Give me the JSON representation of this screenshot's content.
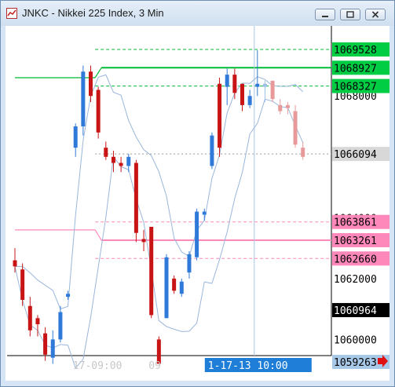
{
  "window": {
    "title": "JNKC - Nikkei 225 Index, 3 Min",
    "buttons": [
      "minimize",
      "restore",
      "close"
    ]
  },
  "chart_data": {
    "type": "candlestick",
    "symbol": "JNKC",
    "title": "JNKC - Nikkei 225 Index, 3 Min",
    "y_axis": {
      "ticks": [
        "1068000",
        "1066000",
        "1064000",
        "1062000",
        "1060000"
      ],
      "tick_values": [
        1068000,
        1066000,
        1064000,
        1062000,
        1060000
      ],
      "range": [
        1058500,
        1070500
      ]
    },
    "price_labels": [
      {
        "text": "1069528",
        "value": 1069528,
        "bg": "#00cc44",
        "fg": "#000000"
      },
      {
        "text": "1068927",
        "value": 1068927,
        "bg": "#00cc44",
        "fg": "#000000"
      },
      {
        "text": "1068327",
        "value": 1068327,
        "bg": "#00cc44",
        "fg": "#000000"
      },
      {
        "text": "1066094",
        "value": 1066094,
        "bg": "#d8d8d8",
        "fg": "#000000"
      },
      {
        "text": "1063861",
        "value": 1063861,
        "bg": "#ff88bb",
        "fg": "#000000"
      },
      {
        "text": "1063261",
        "value": 1063261,
        "bg": "#ff88bb",
        "fg": "#000000"
      },
      {
        "text": "1062660",
        "value": 1062660,
        "bg": "#ff88bb",
        "fg": "#000000"
      },
      {
        "text": "1060964",
        "value": 1060964,
        "bg": "#000000",
        "fg": "#ffffff"
      },
      {
        "text": "1059263",
        "value": 1059263,
        "bg": "#a8c8e8",
        "fg": "#000000"
      }
    ],
    "time_labels": [
      {
        "text": "17-09:00",
        "bar": 12
      },
      {
        "text": "09",
        "bar": 22
      }
    ],
    "crosshair_label": {
      "text": "1-17-13  10:00",
      "bar": 32
    },
    "crosshair_bar": 32,
    "session_start_bar": 11,
    "levels": {
      "green_solid": {
        "value": 1068927,
        "before": 1068600,
        "from_bar": 11
      },
      "green_dashed": [
        1069528,
        1068327
      ],
      "pink_solid": {
        "value": 1063261,
        "before": 1063600,
        "from_bar": 11
      },
      "pink_dashed": [
        1063861,
        1062660
      ],
      "pivot_dashed": 1066094
    },
    "candles": [
      {
        "o": 1062600,
        "h": 1063000,
        "l": 1062200,
        "c": 1062400
      },
      {
        "o": 1062300,
        "h": 1062500,
        "l": 1061100,
        "c": 1061300
      },
      {
        "o": 1061100,
        "h": 1061400,
        "l": 1060100,
        "c": 1060300
      },
      {
        "o": 1060700,
        "h": 1060800,
        "l": 1060100,
        "c": 1060500
      },
      {
        "o": 1060200,
        "h": 1060400,
        "l": 1059300,
        "c": 1059500
      },
      {
        "o": 1059400,
        "h": 1060300,
        "l": 1059200,
        "c": 1060000
      },
      {
        "o": 1060000,
        "h": 1061100,
        "l": 1059900,
        "c": 1060900
      },
      {
        "o": 1061400,
        "h": 1061600,
        "l": 1061300,
        "c": 1061500
      },
      {
        "o": 1066300,
        "h": 1067100,
        "l": 1066000,
        "c": 1067000
      },
      {
        "o": 1067000,
        "h": 1069000,
        "l": 1066700,
        "c": 1068800
      },
      {
        "o": 1068800,
        "h": 1069000,
        "l": 1067800,
        "c": 1068000
      },
      {
        "o": 1068200,
        "h": 1068300,
        "l": 1066600,
        "c": 1066800
      },
      {
        "o": 1066300,
        "h": 1066500,
        "l": 1065900,
        "c": 1066000
      },
      {
        "o": 1066000,
        "h": 1066200,
        "l": 1065500,
        "c": 1065800
      },
      {
        "o": 1065800,
        "h": 1066000,
        "l": 1065500,
        "c": 1065700
      },
      {
        "o": 1065700,
        "h": 1066100,
        "l": 1065500,
        "c": 1066000
      },
      {
        "o": 1065800,
        "h": 1065900,
        "l": 1063200,
        "c": 1063500
      },
      {
        "o": 1063300,
        "h": 1063600,
        "l": 1062900,
        "c": 1063200
      },
      {
        "o": 1063700,
        "h": 1063700,
        "l": 1060700,
        "c": 1060800
      },
      {
        "o": 1060000,
        "h": 1060100,
        "l": 1059200,
        "c": 1059200
      },
      {
        "o": 1060700,
        "h": 1062800,
        "l": 1060700,
        "c": 1062700
      },
      {
        "o": 1062000,
        "h": 1062100,
        "l": 1061500,
        "c": 1061600
      },
      {
        "o": 1061500,
        "h": 1062000,
        "l": 1061400,
        "c": 1061900
      },
      {
        "o": 1062200,
        "h": 1062900,
        "l": 1062000,
        "c": 1062800
      },
      {
        "o": 1062700,
        "h": 1064300,
        "l": 1062600,
        "c": 1064200
      },
      {
        "o": 1064100,
        "h": 1064300,
        "l": 1063900,
        "c": 1064200
      },
      {
        "o": 1065700,
        "h": 1066800,
        "l": 1065600,
        "c": 1066700
      },
      {
        "o": 1068400,
        "h": 1068600,
        "l": 1066000,
        "c": 1066300
      },
      {
        "o": 1068300,
        "h": 1068900,
        "l": 1067700,
        "c": 1068700
      },
      {
        "o": 1068700,
        "h": 1068900,
        "l": 1067900,
        "c": 1068100
      },
      {
        "o": 1068400,
        "h": 1068400,
        "l": 1067500,
        "c": 1067700
      },
      {
        "o": 1067700,
        "h": 1068200,
        "l": 1067600,
        "c": 1068000
      },
      {
        "o": 1068300,
        "h": 1069500,
        "l": 1068000,
        "c": 1068400
      },
      {
        "o": 1068300,
        "h": 1068500,
        "l": 1067800,
        "c": 1068400
      },
      {
        "o": 1068500,
        "h": 1068500,
        "l": 1067800,
        "c": 1067900
      },
      {
        "o": 1067700,
        "h": 1067900,
        "l": 1067400,
        "c": 1067500
      },
      {
        "o": 1067700,
        "h": 1067800,
        "l": 1067400,
        "c": 1067600
      },
      {
        "o": 1067500,
        "h": 1067700,
        "l": 1066300,
        "c": 1066400
      },
      {
        "o": 1066300,
        "h": 1066500,
        "l": 1065900,
        "c": 1066000
      }
    ],
    "colors": {
      "up": "#2f79d8",
      "down": "#c81414",
      "up_after": "#9cc0e8",
      "down_after": "#e89a9a",
      "green": "#00bb33",
      "pink": "#ff88bb",
      "band": "#9ab6dc"
    },
    "nav_arrow": "red-arrow-right"
  }
}
